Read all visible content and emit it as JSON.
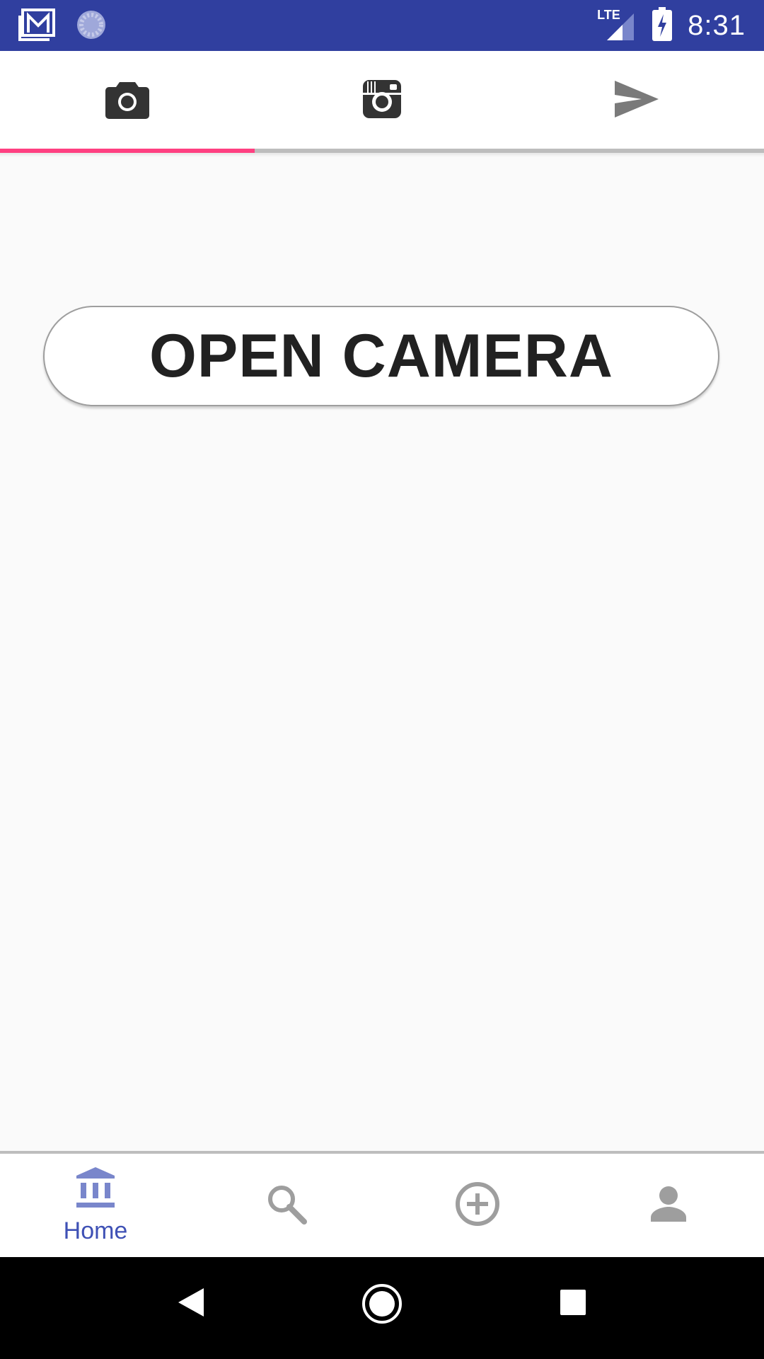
{
  "status_bar": {
    "time": "8:31",
    "network_type": "LTE",
    "left_icons": [
      "gmail-icon",
      "sync-icon"
    ],
    "right_icons": [
      "signal-icon",
      "battery-charging-icon"
    ],
    "background_color": "#303f9f"
  },
  "top_tabs": {
    "items": [
      {
        "icon": "camera-icon",
        "selected": true
      },
      {
        "icon": "instagram-camera-icon",
        "selected": false
      },
      {
        "icon": "send-icon",
        "selected": false
      }
    ],
    "indicator_color": "#ff4081"
  },
  "main": {
    "open_camera_label": "OPEN CAMERA"
  },
  "bottom_nav": {
    "items": [
      {
        "icon": "home-bank-icon",
        "label": "Home",
        "selected": true
      },
      {
        "icon": "search-icon",
        "label": "",
        "selected": false
      },
      {
        "icon": "add-circle-icon",
        "label": "",
        "selected": false
      },
      {
        "icon": "person-icon",
        "label": "",
        "selected": false
      }
    ],
    "active_color": "#3f51b5",
    "inactive_color": "#9e9e9e"
  },
  "system_nav": {
    "buttons": [
      "back-icon",
      "home-icon",
      "recents-icon"
    ]
  }
}
